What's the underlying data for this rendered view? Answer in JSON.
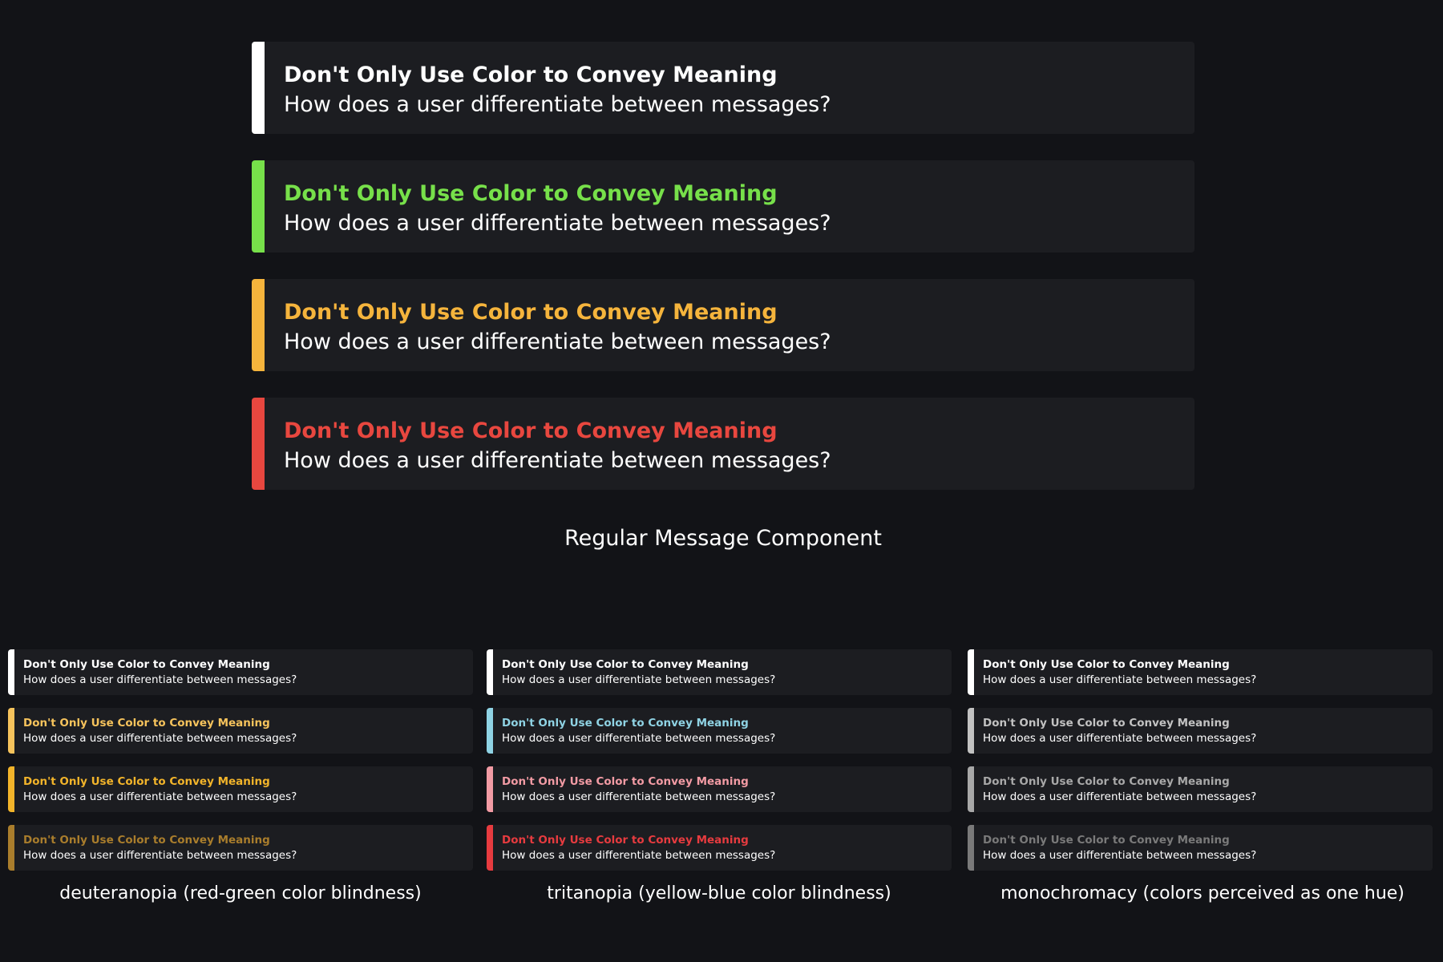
{
  "message": {
    "title": "Don't Only Use Color to Convey Meaning",
    "body": "How does a user differentiate between messages?"
  },
  "main": {
    "caption": "Regular Message Component",
    "accents": [
      "#ffffff",
      "#77e04a",
      "#f5b43c",
      "#e8473f"
    ]
  },
  "panels": [
    {
      "caption": "deuteranopia (red-green color blindness)",
      "accents": [
        "#ffffff",
        "#f6c35c",
        "#f2b42a",
        "#a97d2c"
      ]
    },
    {
      "caption": "tritanopia (yellow-blue color blindness)",
      "accents": [
        "#ffffff",
        "#8fd3e4",
        "#f29ba4",
        "#e73b3f"
      ]
    },
    {
      "caption": "monochromacy (colors perceived as one hue)",
      "accents": [
        "#ffffff",
        "#c2c2c2",
        "#a8a8a8",
        "#7a7a7a"
      ]
    }
  ]
}
